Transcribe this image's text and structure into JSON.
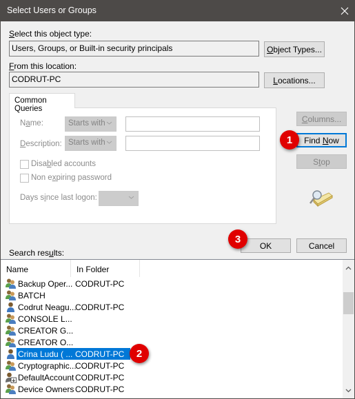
{
  "window": {
    "title": "Select Users or Groups",
    "close_icon": "close-icon"
  },
  "object_type": {
    "label_ul": "S",
    "label_rest": "elect this object type:",
    "value": "Users, Groups, or Built-in security principals",
    "button_ul": "O",
    "button_rest": "bject Types..."
  },
  "location": {
    "label_ul": "F",
    "label_rest": "rom this location:",
    "value": "CODRUT-PC",
    "button_ul": "L",
    "button_rest": "ocations..."
  },
  "queries": {
    "tab_label": "Common Queries",
    "name_label_a": "N",
    "name_label_ul": "a",
    "name_label_b": "me:",
    "name_mode": "Starts with",
    "name_value": "",
    "desc_label_ul": "D",
    "desc_label_rest": "escription:",
    "desc_mode": "Starts with",
    "desc_value": "",
    "disabled_a": "Disa",
    "disabled_ul": "b",
    "disabled_b": "led accounts",
    "disabled_checked": false,
    "nonexp_a": "Non e",
    "nonexp_ul": "x",
    "nonexp_b": "piring password",
    "nonexp_checked": false,
    "days_a": "Days s",
    "days_ul": "i",
    "days_b": "nce last logon:",
    "days_value": ""
  },
  "side_buttons": {
    "columns_ul": "C",
    "columns_rest": "olumns...",
    "find_a": "Find ",
    "find_ul": "N",
    "find_b": "ow",
    "stop_a": "S",
    "stop_ul": "t",
    "stop_b": "op",
    "search_icon": "search-folder-icon"
  },
  "dialog_buttons": {
    "ok": "OK",
    "cancel": "Cancel"
  },
  "results": {
    "label_a": "Search res",
    "label_ul": "u",
    "label_b": "lts:",
    "columns": [
      "Name",
      "In Folder"
    ],
    "rows": [
      {
        "name": "Backup Oper...",
        "folder": "CODRUT-PC",
        "icon": "group-icon",
        "selected": false
      },
      {
        "name": "BATCH",
        "folder": "",
        "icon": "group-icon",
        "selected": false
      },
      {
        "name": "Codrut Neagu...",
        "folder": "CODRUT-PC",
        "icon": "user-icon",
        "selected": false
      },
      {
        "name": "CONSOLE L...",
        "folder": "",
        "icon": "group-icon",
        "selected": false
      },
      {
        "name": "CREATOR G...",
        "folder": "",
        "icon": "group-icon",
        "selected": false
      },
      {
        "name": "CREATOR O...",
        "folder": "",
        "icon": "group-icon",
        "selected": false
      },
      {
        "name": "Crina Ludu (  ...",
        "folder": "CODRUT-PC",
        "icon": "user-icon",
        "selected": true
      },
      {
        "name": "Cryptographic...",
        "folder": "CODRUT-PC",
        "icon": "group-icon",
        "selected": false
      },
      {
        "name": "DefaultAccount",
        "folder": "CODRUT-PC",
        "icon": "user-download-icon",
        "selected": false
      },
      {
        "name": "Device Owners",
        "folder": "CODRUT-PC",
        "icon": "group-icon",
        "selected": false
      }
    ]
  },
  "annotations": {
    "step1": "1",
    "step2": "2",
    "step3": "3"
  },
  "colors": {
    "accent": "#0078d7",
    "badge": "#e00000",
    "titlebar": "#4d4a48"
  }
}
